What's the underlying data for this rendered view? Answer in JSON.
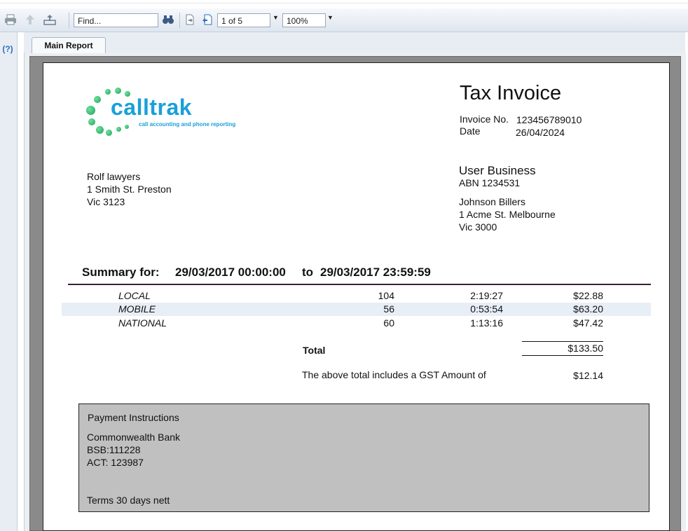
{
  "toolbar": {
    "icons": [
      "print-icon",
      "up-arrow-icon",
      "export-icon",
      "binoculars-icon",
      "page-back-icon",
      "page-forward-icon"
    ],
    "find_placeholder": "Find...",
    "page_value": "1 of 5",
    "zoom_value": "100%"
  },
  "sidebar": {
    "help_label": "(?)"
  },
  "tabs": {
    "main_report": "Main Report"
  },
  "logo": {
    "word": "calltrak",
    "tagline": "call accounting and phone reporting"
  },
  "invoice": {
    "title": "Tax Invoice",
    "number_label": "Invoice No.",
    "number_value": "123456789010",
    "date_label": "Date",
    "date_value": "26/04/2024"
  },
  "customer": {
    "line1": "Rolf lawyers",
    "line2": "1 Smith St. Preston",
    "line3": "Vic 3123"
  },
  "business": {
    "name": "User Business",
    "abn": "ABN 1234531",
    "line1": "Johnson Billers",
    "line2": "1 Acme St. Melbourne",
    "line3": "Vic 3000"
  },
  "summary": {
    "label": "Summary for:",
    "from": "29/03/2017 00:00:00",
    "to_label": "to",
    "to": "29/03/2017 23:59:59"
  },
  "rows": [
    {
      "type": "LOCAL",
      "calls": "104",
      "duration": "2:19:27",
      "cost": "$22.88"
    },
    {
      "type": "MOBILE",
      "calls": "56",
      "duration": "0:53:54",
      "cost": "$63.20"
    },
    {
      "type": "NATIONAL",
      "calls": "60",
      "duration": "1:13:16",
      "cost": "$47.42"
    }
  ],
  "totals": {
    "total_label": "Total",
    "total_value": "$133.50",
    "gst_label": "The above total includes a GST Amount of",
    "gst_value": "$12.14"
  },
  "payment": {
    "heading": "Payment Instructions",
    "bank": "Commonwealth Bank",
    "bsb": "BSB:111228",
    "act": "ACT: 123987",
    "terms": "Terms 30 days nett"
  },
  "colors": {
    "logo_blue": "#1aa0d8",
    "logo_green": "#19a357",
    "rule": "#3a1f33",
    "payment_bg": "#c0c0c0",
    "band": "#e8eef6"
  }
}
